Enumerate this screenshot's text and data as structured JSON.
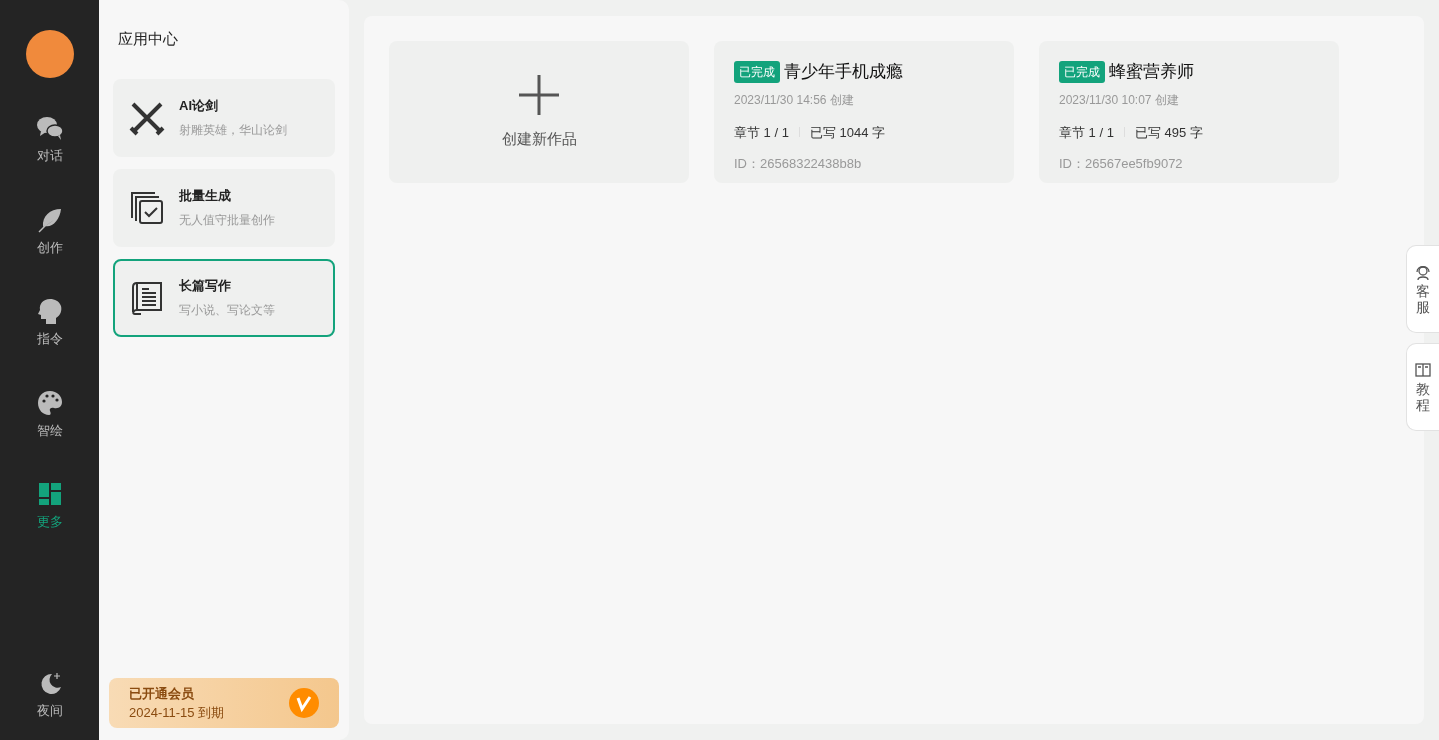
{
  "nav": {
    "items": [
      {
        "kind": "chat",
        "label": "对话",
        "selected": false
      },
      {
        "kind": "feather",
        "label": "创作",
        "selected": false
      },
      {
        "kind": "head",
        "label": "指令",
        "selected": false
      },
      {
        "kind": "palette",
        "label": "智绘",
        "selected": false
      },
      {
        "kind": "grid",
        "label": "更多",
        "selected": true
      }
    ],
    "night": {
      "label": "夜间"
    }
  },
  "panel": {
    "title": "应用中心",
    "apps": [
      {
        "kind": "swords",
        "title": "AI论剑",
        "subtitle": "射雕英雄，华山论剑",
        "selected": false
      },
      {
        "kind": "copies",
        "title": "批量生成",
        "subtitle": "无人值守批量创作",
        "selected": false
      },
      {
        "kind": "book",
        "title": "长篇写作",
        "subtitle": "写小说、写论文等",
        "selected": true
      }
    ],
    "membership": {
      "title": "已开通会员",
      "expiry": "2024-11-15 到期"
    }
  },
  "create_card": {
    "label": "创建新作品"
  },
  "works": [
    {
      "status": "已完成",
      "title": "青少年手机成瘾",
      "created": "2023/11/30 14:56 创建",
      "chapters": "章节 1 / 1",
      "words": "已写 1044 字",
      "id": "ID：26568322438b8b"
    },
    {
      "status": "已完成",
      "title": "蜂蜜营养师",
      "created": "2023/11/30 10:07 创建",
      "chapters": "章节 1 / 1",
      "words": "已写 495 字",
      "id": "ID：26567ee5fb9072"
    }
  ],
  "side_tabs": [
    {
      "kind": "headset",
      "label": "客服"
    },
    {
      "kind": "book",
      "label": "教程"
    }
  ]
}
